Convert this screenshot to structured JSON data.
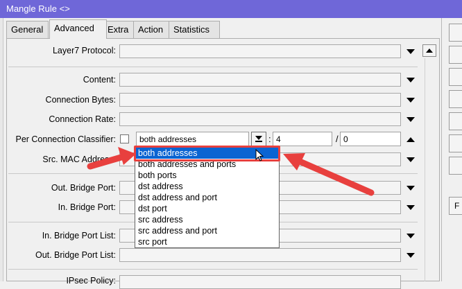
{
  "window": {
    "title": "Mangle Rule <>"
  },
  "tabs": [
    {
      "label": "General"
    },
    {
      "label": "Advanced",
      "active": true
    },
    {
      "label": "Extra"
    },
    {
      "label": "Action"
    },
    {
      "label": "Statistics"
    }
  ],
  "side_window": {
    "button_label": "F"
  },
  "form": {
    "layer7_protocol": {
      "label": "Layer7 Protocol:",
      "value": ""
    },
    "content": {
      "label": "Content:",
      "value": ""
    },
    "connection_bytes": {
      "label": "Connection Bytes:",
      "value": ""
    },
    "connection_rate": {
      "label": "Connection Rate:",
      "value": ""
    },
    "per_connection_classifier": {
      "label": "Per Connection Classifier:",
      "checked": false,
      "type_value": "both addresses",
      "colon": ":",
      "every": "4",
      "slash": "/",
      "remainder": "0"
    },
    "src_mac_address": {
      "label": "Src. MAC Address:",
      "value": ""
    },
    "out_bridge_port": {
      "label": "Out. Bridge Port:",
      "value": ""
    },
    "in_bridge_port": {
      "label": "In. Bridge Port:",
      "value": ""
    },
    "in_bridge_port_list": {
      "label": "In. Bridge Port List:",
      "value": ""
    },
    "out_bridge_port_list": {
      "label": "Out. Bridge Port List:",
      "value": ""
    },
    "ipsec_policy": {
      "label": "IPsec Policy:",
      "value": ""
    }
  },
  "dropdown": {
    "selected_index": 0,
    "options": [
      "both addresses",
      "both addresses and ports",
      "both ports",
      "dst address",
      "dst address and port",
      "dst port",
      "src address",
      "src address and port",
      "src port"
    ]
  },
  "colors": {
    "titlebar": "#6f67d8",
    "selection": "#0a64d2",
    "annotation": "#e8403e"
  }
}
